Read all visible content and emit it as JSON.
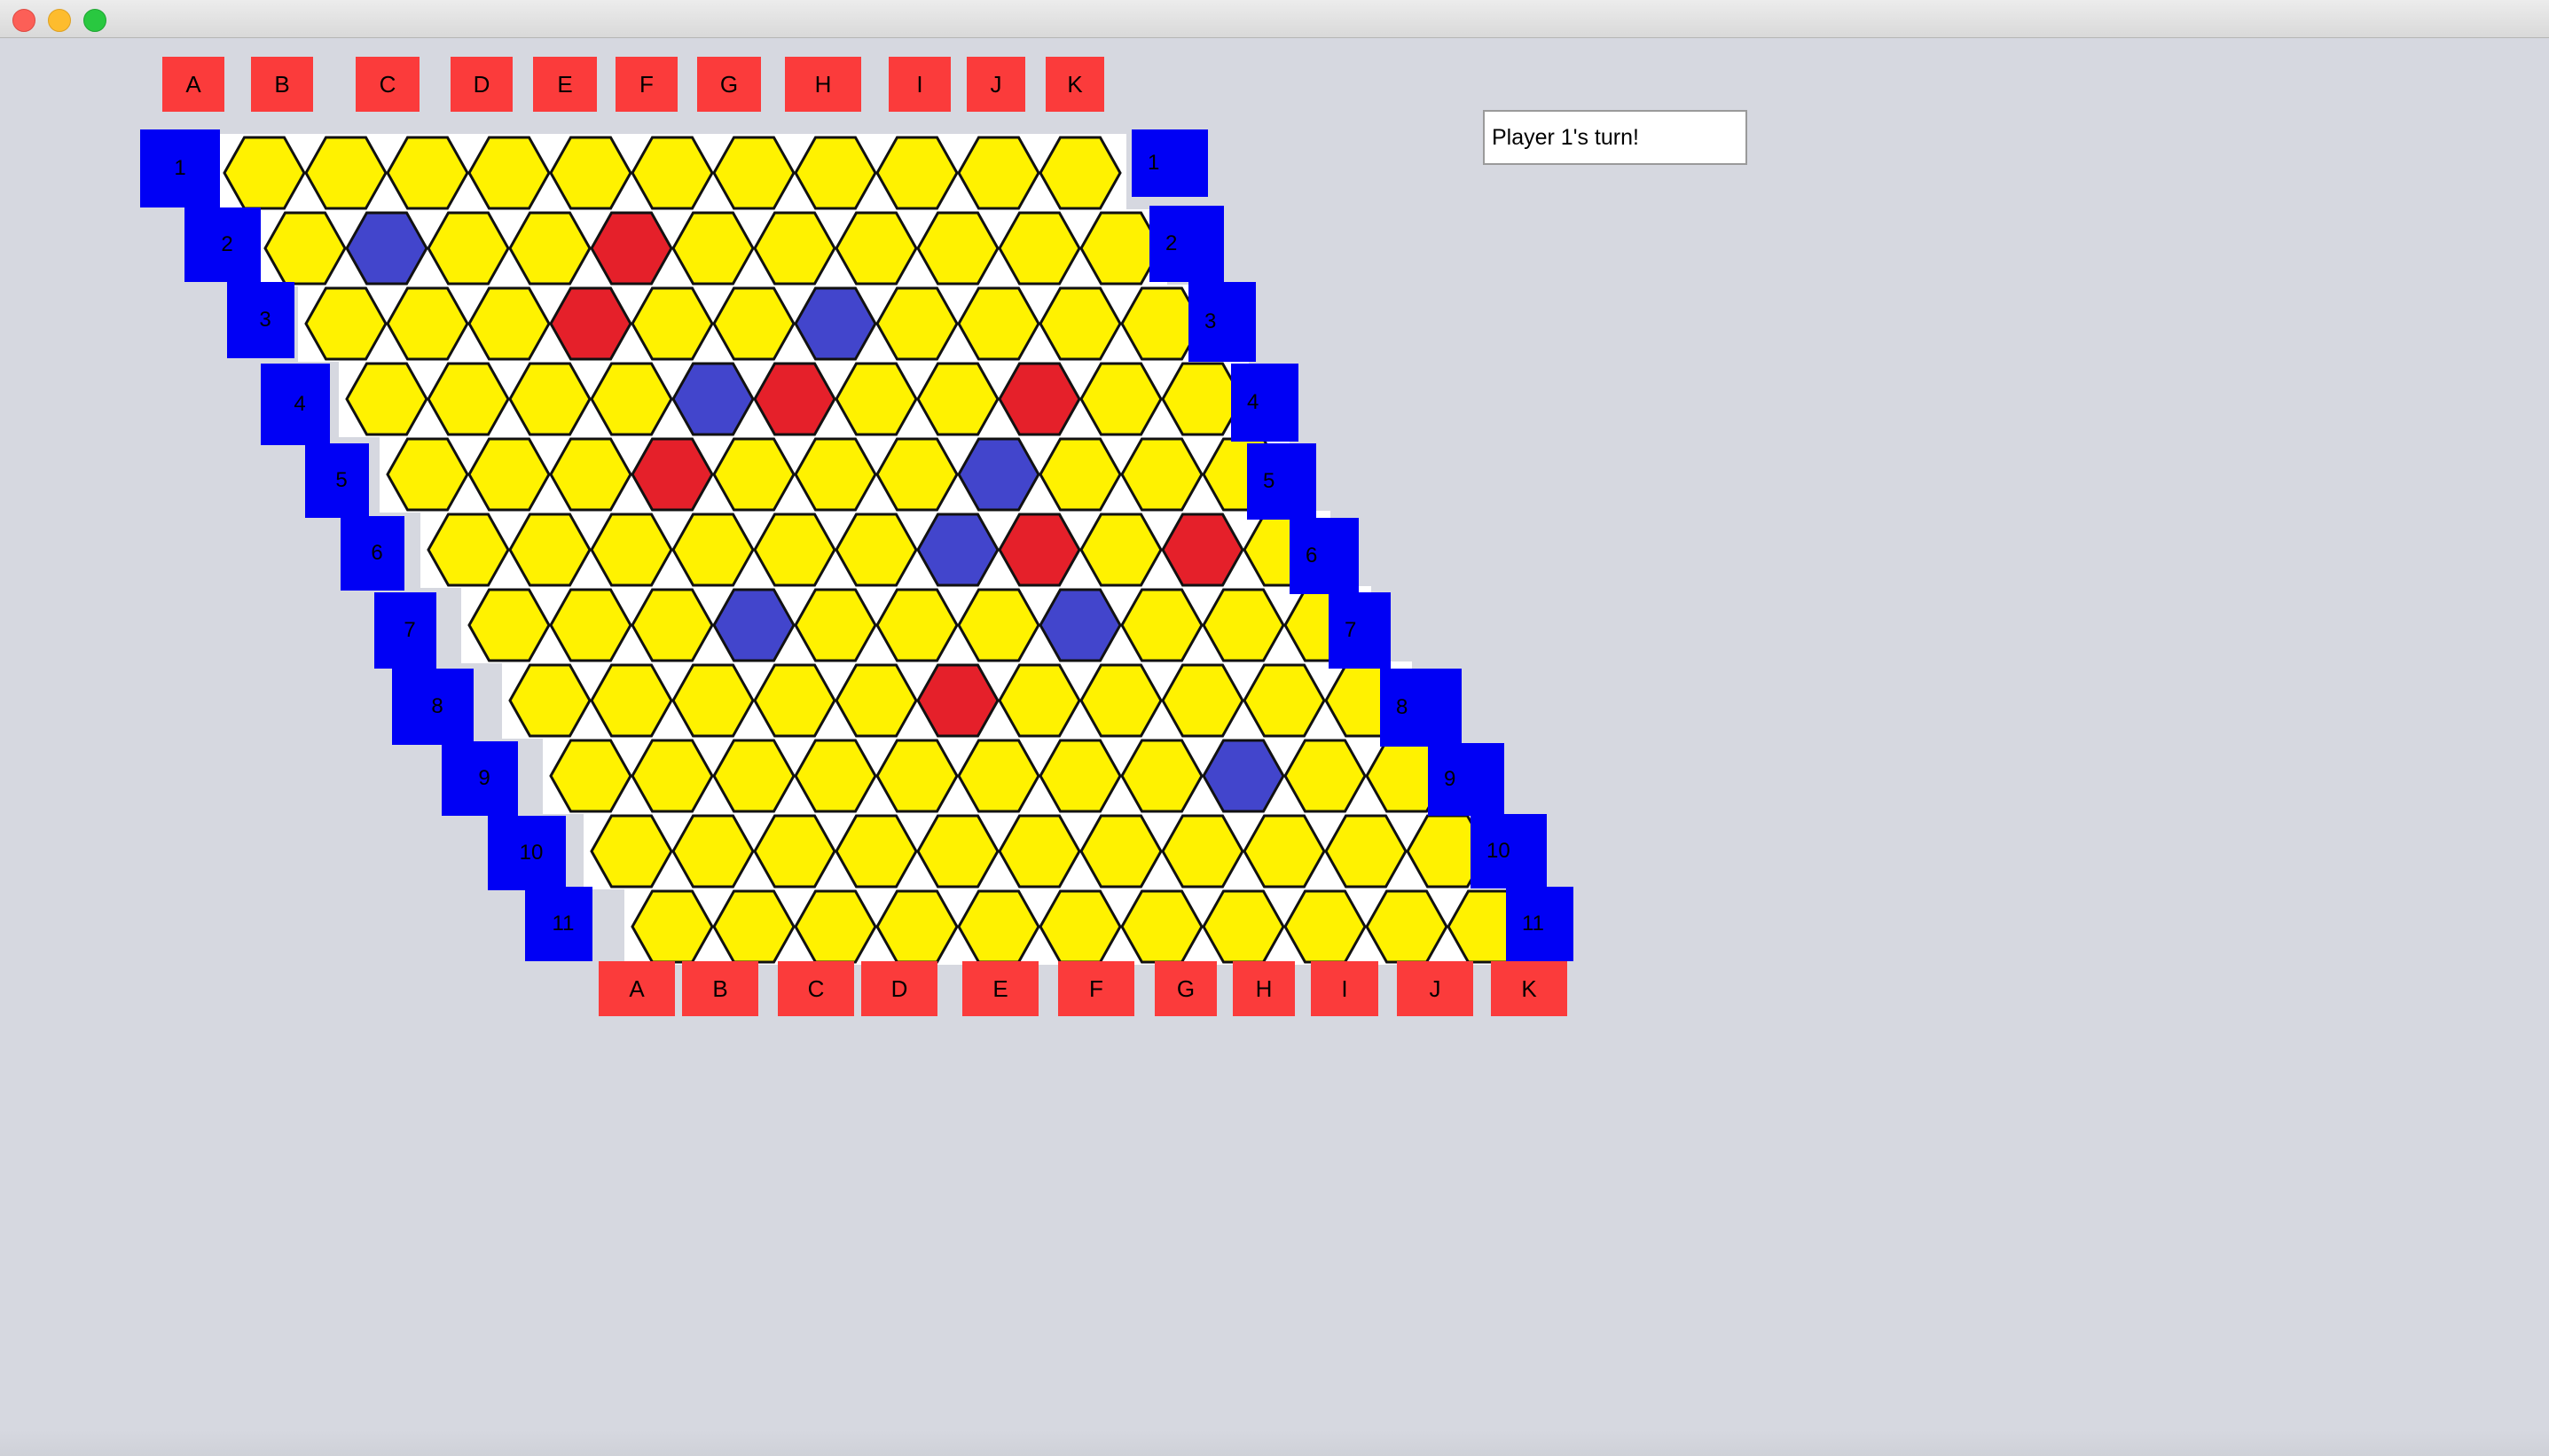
{
  "window": {
    "close_icon": "close-traffic-light",
    "minimize_icon": "minimize-traffic-light",
    "maximize_icon": "maximize-traffic-light"
  },
  "colors": {
    "background": "#d6d8e0",
    "column_label_bg": "#fb3b3b",
    "row_label_bg": "#0000f5",
    "empty_cell": "#fff200",
    "red_stone": "#e5202a",
    "blue_stone": "#4245cc",
    "cell_outline": "#111111",
    "board_band": "#ffffff"
  },
  "status": {
    "message": "Player 1's turn!"
  },
  "board": {
    "size": 11,
    "top_column_labels": [
      "A",
      "B",
      "C",
      "D",
      "E",
      "F",
      "G",
      "H",
      "I",
      "J",
      "K"
    ],
    "bottom_column_labels": [
      "A",
      "B",
      "C",
      "D",
      "E",
      "F",
      "G",
      "H",
      "I",
      "J",
      "K"
    ],
    "row_labels": [
      "1",
      "2",
      "3",
      "4",
      "5",
      "6",
      "7",
      "8",
      "9",
      "10",
      "11"
    ],
    "cells": [
      "...........",
      ".B..R......",
      "...R..B....",
      "....BR..R..",
      "...R...B...",
      "......BR.R..",
      "...B...B...",
      ".....R.....",
      "........B..",
      "...........",
      "..........."
    ],
    "legend": {
      ".": "empty",
      "R": "red",
      "B": "blue"
    }
  }
}
